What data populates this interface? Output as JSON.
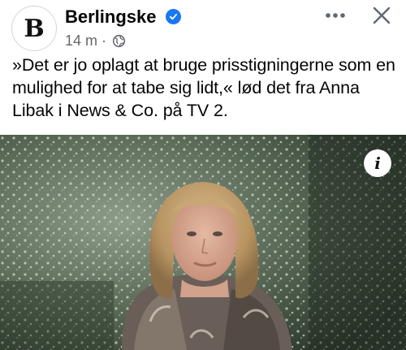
{
  "post": {
    "page_logo_letter": "B",
    "page_name": "Berlingske",
    "time_ago": "14 m",
    "separator": "·",
    "text": "»Det er jo oplagt at bruge prisstigningerne som en mulighed for at tabe sig lidt,« lød det fra Anna Libak i News & Co. på TV 2.",
    "info_label": "i"
  },
  "icons": {
    "verified": "verified-badge-icon",
    "audience": "globe-icon",
    "more": "more-dots-icon",
    "close": "close-icon",
    "info": "info-icon"
  },
  "colors": {
    "verified_blue": "#1877f2",
    "meta_gray": "#65676b",
    "text": "#050505"
  }
}
